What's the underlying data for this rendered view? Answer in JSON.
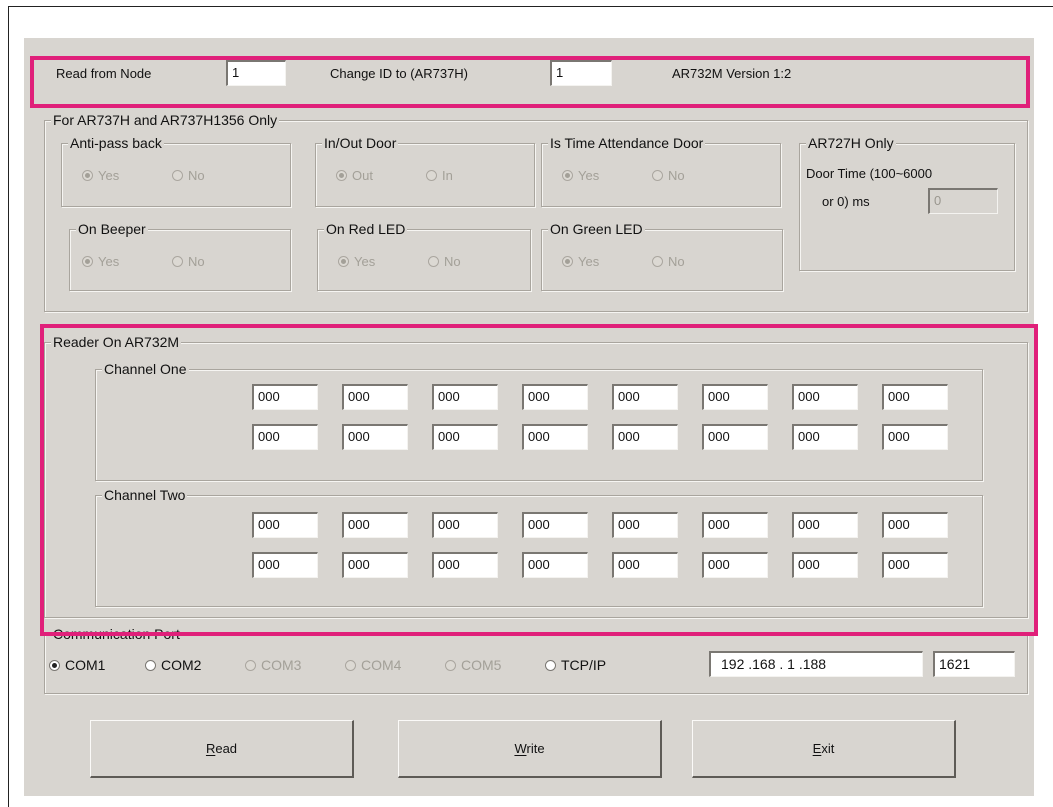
{
  "colors": {
    "highlight": "#e0207a",
    "dialog_bg": "#d8d5d0"
  },
  "top": {
    "read_from_node_label": "Read from Node",
    "read_from_node_value": "1",
    "change_id_label": "Change ID to (AR737H)",
    "change_id_value": "1",
    "version": "AR732M Version 1:2"
  },
  "ar737": {
    "title": "For AR737H and AR737H1356 Only",
    "antipass": {
      "title": "Anti-pass back",
      "opt1": "Yes",
      "opt2": "No",
      "selected": "Yes"
    },
    "inout": {
      "title": "In/Out Door",
      "opt1": "Out",
      "opt2": "In",
      "selected": "Out"
    },
    "attendance": {
      "title": "Is Time Attendance Door",
      "opt1": "Yes",
      "opt2": "No",
      "selected": "Yes"
    },
    "beeper": {
      "title": "On Beeper",
      "opt1": "Yes",
      "opt2": "No",
      "selected": "Yes"
    },
    "redled": {
      "title": "On Red LED",
      "opt1": "Yes",
      "opt2": "No",
      "selected": "Yes"
    },
    "greenled": {
      "title": "On Green LED",
      "opt1": "Yes",
      "opt2": "No",
      "selected": "Yes"
    },
    "ar727": {
      "title": "AR727H Only",
      "line1": "Door Time  (100~6000",
      "line2": "or 0) ms",
      "value": "0"
    }
  },
  "reader": {
    "title": "Reader On AR732M",
    "ch1": {
      "title": "Channel One",
      "row1": [
        "000",
        "000",
        "000",
        "000",
        "000",
        "000",
        "000",
        "000"
      ],
      "row2": [
        "000",
        "000",
        "000",
        "000",
        "000",
        "000",
        "000",
        "000"
      ]
    },
    "ch2": {
      "title": "Channel Two",
      "row1": [
        "000",
        "000",
        "000",
        "000",
        "000",
        "000",
        "000",
        "000"
      ],
      "row2": [
        "000",
        "000",
        "000",
        "000",
        "000",
        "000",
        "000",
        "000"
      ]
    }
  },
  "comm": {
    "title": "Communication Port",
    "ports": [
      "COM1",
      "COM2",
      "COM3",
      "COM4",
      "COM5",
      "TCP/IP"
    ],
    "selected": "COM1",
    "ip": "192 .168 .  1  .188",
    "port": "1621"
  },
  "buttons": {
    "read": {
      "first": "R",
      "rest": "ead"
    },
    "write": {
      "first": "W",
      "rest": "rite"
    },
    "exit": {
      "first": "E",
      "rest": "xit"
    }
  }
}
